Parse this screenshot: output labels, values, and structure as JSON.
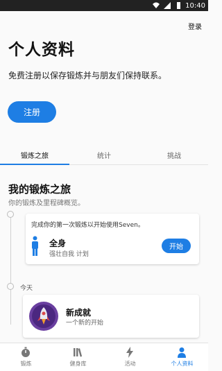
{
  "status_bar": {
    "time": "10:40"
  },
  "header": {
    "login_label": "登录"
  },
  "page": {
    "title": "个人资料",
    "description": "免费注册以保存锻炼并与朋友们保持联系。",
    "register_label": "注册"
  },
  "tabs": [
    {
      "label": "锻炼之旅",
      "active": true
    },
    {
      "label": "统计",
      "active": false
    },
    {
      "label": "挑战",
      "active": false
    }
  ],
  "journey": {
    "title": "我的锻炼之旅",
    "subtitle": "你的锻炼及里程碑概览。",
    "first_card": {
      "prompt": "完成你的第一次锻炼以开始使用Seven。",
      "name": "全身",
      "subtitle": "强壮自我 计划",
      "start_label": "开始"
    },
    "today_label": "今天",
    "achievement": {
      "name": "新成就",
      "subtitle": "一个新的开始"
    }
  },
  "bottom_nav": [
    {
      "label": "锻炼",
      "icon": "stopwatch-icon",
      "active": false
    },
    {
      "label": "健身库",
      "icon": "library-icon",
      "active": false
    },
    {
      "label": "活动",
      "icon": "lightning-icon",
      "active": false
    },
    {
      "label": "个人资料",
      "icon": "person-icon",
      "active": true
    }
  ],
  "colors": {
    "accent": "#1e7ee4",
    "badge_bg": "#6a3fa0",
    "status_bar": "#222222"
  }
}
